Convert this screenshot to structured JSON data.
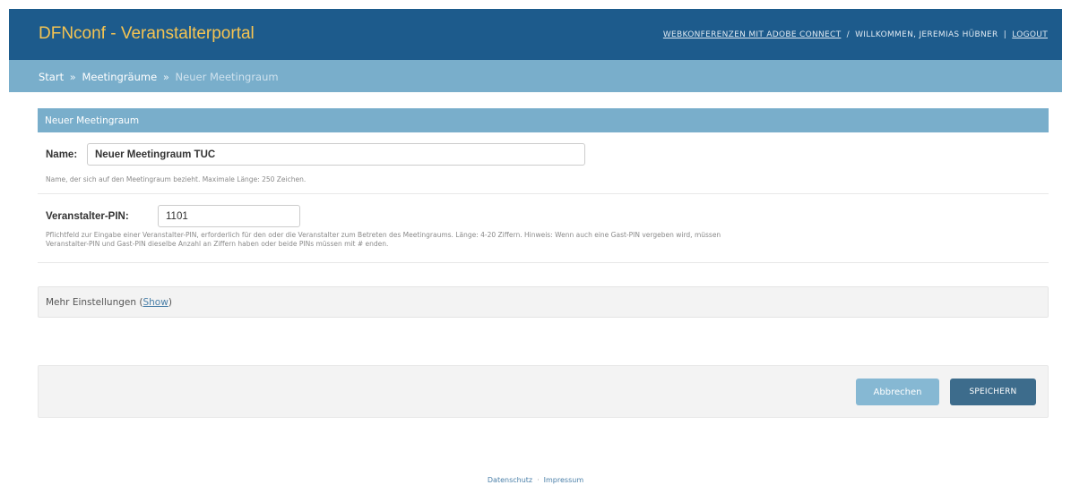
{
  "header": {
    "brand": "DFNconf - Veranstalterportal",
    "links": {
      "adobe": "WEBKONFERENZEN MIT ADOBE CONNECT",
      "separator1": "/",
      "welcome": "WILLKOMMEN, JEREMIAS HÜBNER",
      "separator2": "|",
      "logout": "LOGOUT"
    }
  },
  "breadcrumbs": {
    "start": "Start",
    "sep": "»",
    "rooms": "Meetingräume",
    "current": "Neuer Meetingraum"
  },
  "form": {
    "module_title": "Neuer Meetingraum",
    "name": {
      "label": "Name:",
      "value": "Neuer Meetingraum TUC",
      "help": "Name, der sich auf den Meetingraum bezieht. Maximale Länge: 250 Zeichen."
    },
    "pin": {
      "label": "Veranstalter-PIN:",
      "value": "1101",
      "help_line1": "Pflichtfeld zur Eingabe einer Veranstalter-PIN, erforderlich für den oder die Veranstalter zum Betreten des Meetingraums. Länge: 4-20 Ziffern. Hinweis: Wenn auch eine Gast-PIN vergeben wird, müssen",
      "help_line2": "Veranstalter-PIN und Gast-PIN dieselbe Anzahl an Ziffern haben oder beide PINs müssen mit # enden."
    },
    "more_settings": {
      "label": "Mehr Einstellungen",
      "open_paren": "(",
      "toggle": "Show",
      "close_paren": ")"
    },
    "buttons": {
      "cancel": "Abbrechen",
      "save": "SPEICHERN"
    }
  },
  "footer": {
    "privacy": "Datenschutz",
    "dot": "·",
    "imprint": "Impressum"
  },
  "colors": {
    "header_bg": "#1d5b8c",
    "brand_text": "#f5c452",
    "breadcrumb_bg": "#79aecb",
    "save_button": "#3d6c8c",
    "cancel_button": "#86b8d3"
  }
}
